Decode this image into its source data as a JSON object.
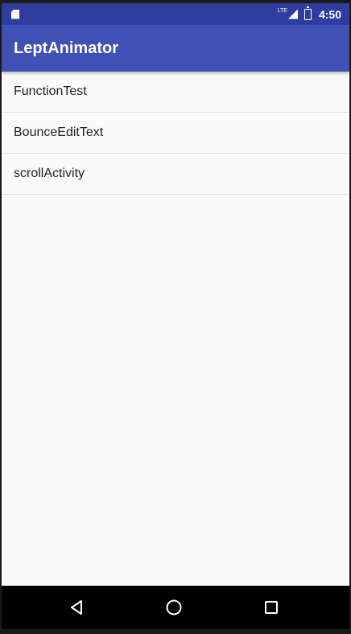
{
  "status_bar": {
    "network": "LTE",
    "time": "4:50",
    "icons": [
      "sd-card-icon",
      "lte-icon",
      "signal-icon",
      "battery-charging-icon"
    ]
  },
  "app_bar": {
    "title": "LeptAnimator"
  },
  "list": {
    "items": [
      {
        "label": "FunctionTest"
      },
      {
        "label": "BounceEditText"
      },
      {
        "label": "scrollActivity"
      }
    ]
  },
  "nav_bar": {
    "buttons": [
      "back-icon",
      "home-icon",
      "recents-icon"
    ]
  },
  "colors": {
    "status_bar": "#2f3e9e",
    "app_bar": "#3f51b5",
    "background": "#fafafa",
    "nav_bar": "#000000"
  }
}
